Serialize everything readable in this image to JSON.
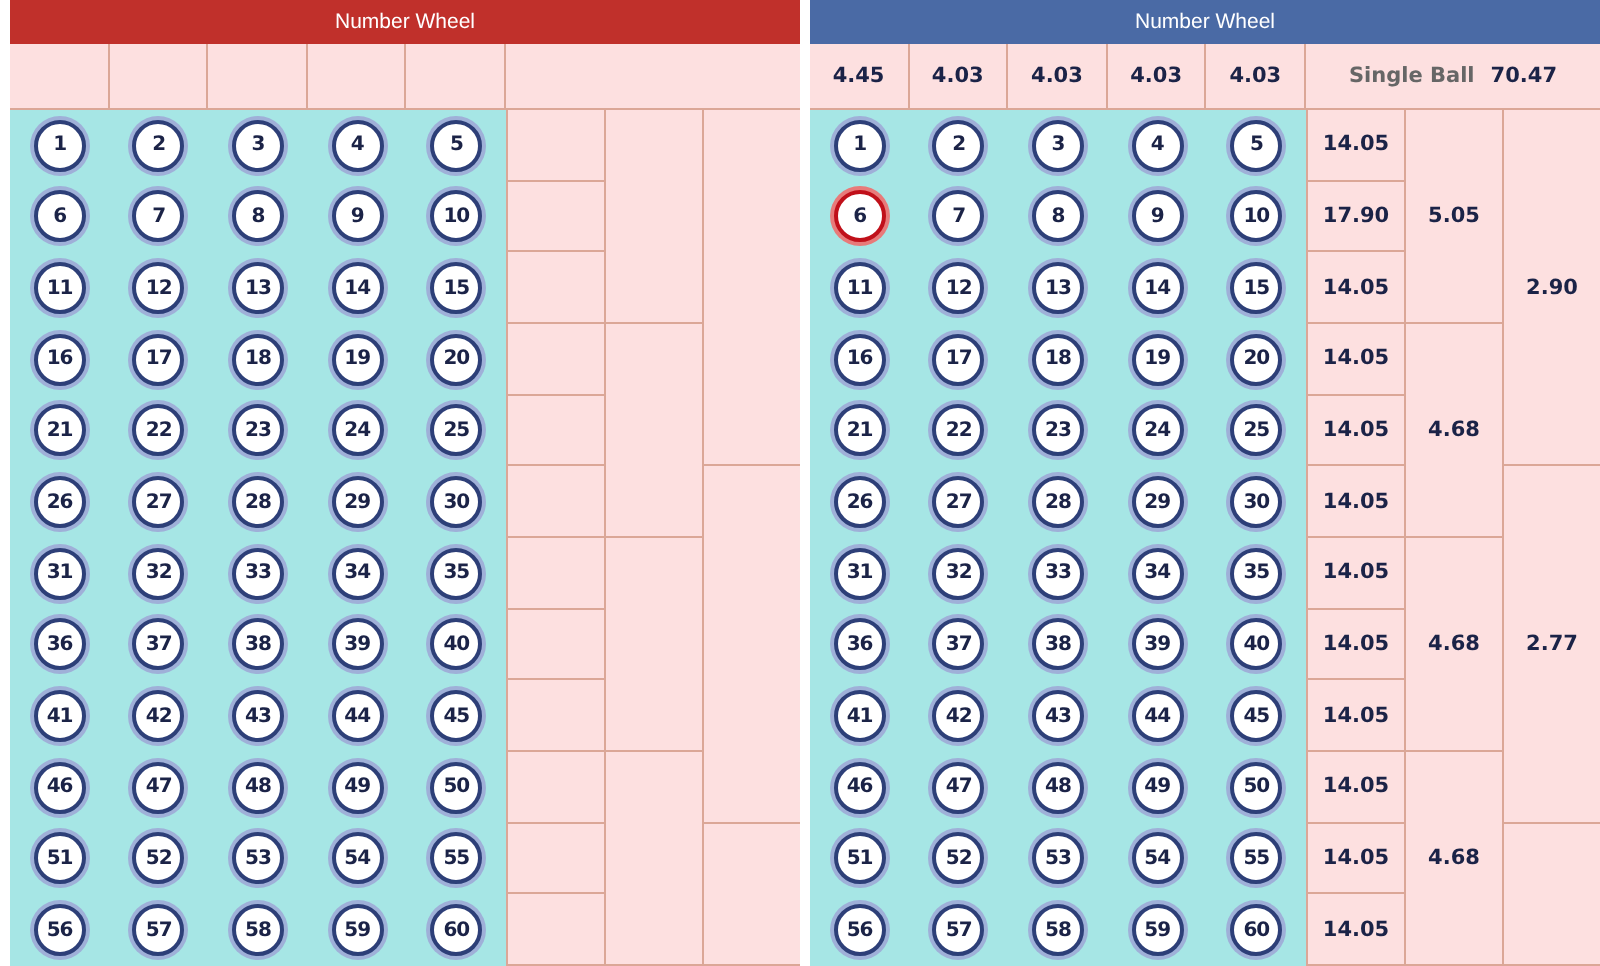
{
  "panels": [
    {
      "title": "Number Wheel",
      "color": "#c0302b",
      "balls": [
        {
          "label": "1",
          "selected": false
        },
        {
          "label": "2",
          "selected": false
        },
        {
          "label": "3",
          "selected": false
        },
        {
          "label": "4",
          "selected": false
        },
        {
          "label": "5",
          "selected": false
        },
        {
          "label": "6",
          "selected": false
        },
        {
          "label": "7",
          "selected": false
        },
        {
          "label": "8",
          "selected": false
        },
        {
          "label": "9",
          "selected": false
        },
        {
          "label": "10",
          "selected": false
        },
        {
          "label": "11",
          "selected": false
        },
        {
          "label": "12",
          "selected": false
        },
        {
          "label": "13",
          "selected": false
        },
        {
          "label": "14",
          "selected": false
        },
        {
          "label": "15",
          "selected": false
        },
        {
          "label": "16",
          "selected": false
        },
        {
          "label": "17",
          "selected": false
        },
        {
          "label": "18",
          "selected": false
        },
        {
          "label": "19",
          "selected": false
        },
        {
          "label": "20",
          "selected": false
        },
        {
          "label": "21",
          "selected": false
        },
        {
          "label": "22",
          "selected": false
        },
        {
          "label": "23",
          "selected": false
        },
        {
          "label": "24",
          "selected": false
        },
        {
          "label": "25",
          "selected": false
        },
        {
          "label": "26",
          "selected": false
        },
        {
          "label": "27",
          "selected": false
        },
        {
          "label": "28",
          "selected": false
        },
        {
          "label": "29",
          "selected": false
        },
        {
          "label": "30",
          "selected": false
        },
        {
          "label": "31",
          "selected": false
        },
        {
          "label": "32",
          "selected": false
        },
        {
          "label": "33",
          "selected": false
        },
        {
          "label": "34",
          "selected": false
        },
        {
          "label": "35",
          "selected": false
        },
        {
          "label": "36",
          "selected": false
        },
        {
          "label": "37",
          "selected": false
        },
        {
          "label": "38",
          "selected": false
        },
        {
          "label": "39",
          "selected": false
        },
        {
          "label": "40",
          "selected": false
        },
        {
          "label": "41",
          "selected": false
        },
        {
          "label": "42",
          "selected": false
        },
        {
          "label": "43",
          "selected": false
        },
        {
          "label": "44",
          "selected": false
        },
        {
          "label": "45",
          "selected": false
        },
        {
          "label": "46",
          "selected": false
        },
        {
          "label": "47",
          "selected": false
        },
        {
          "label": "48",
          "selected": false
        },
        {
          "label": "49",
          "selected": false
        },
        {
          "label": "50",
          "selected": false
        },
        {
          "label": "51",
          "selected": false
        },
        {
          "label": "52",
          "selected": false
        },
        {
          "label": "53",
          "selected": false
        },
        {
          "label": "54",
          "selected": false
        },
        {
          "label": "55",
          "selected": false
        },
        {
          "label": "56",
          "selected": false
        },
        {
          "label": "57",
          "selected": false
        },
        {
          "label": "58",
          "selected": false
        },
        {
          "label": "59",
          "selected": false
        },
        {
          "label": "60",
          "selected": false
        }
      ]
    },
    {
      "title": "Number Wheel",
      "color": "#4a6aa5",
      "column_odds": [
        "4.45",
        "4.03",
        "4.03",
        "4.03",
        "4.03"
      ],
      "single_ball": {
        "label": "Single Ball",
        "odds": "70.47"
      },
      "row_odds": [
        "14.05",
        "17.90",
        "14.05",
        "14.05",
        "14.05",
        "14.05",
        "14.05",
        "14.05",
        "14.05",
        "14.05",
        "14.05",
        "14.05"
      ],
      "triple_odds": [
        "5.05",
        "4.68",
        "4.68",
        "4.68"
      ],
      "group_odds": [
        "2.90",
        "2.77"
      ],
      "balls": [
        {
          "label": "1",
          "selected": false
        },
        {
          "label": "2",
          "selected": false
        },
        {
          "label": "3",
          "selected": false
        },
        {
          "label": "4",
          "selected": false
        },
        {
          "label": "5",
          "selected": false
        },
        {
          "label": "6",
          "selected": true
        },
        {
          "label": "7",
          "selected": false
        },
        {
          "label": "8",
          "selected": false
        },
        {
          "label": "9",
          "selected": false
        },
        {
          "label": "10",
          "selected": false
        },
        {
          "label": "11",
          "selected": false
        },
        {
          "label": "12",
          "selected": false
        },
        {
          "label": "13",
          "selected": false
        },
        {
          "label": "14",
          "selected": false
        },
        {
          "label": "15",
          "selected": false
        },
        {
          "label": "16",
          "selected": false
        },
        {
          "label": "17",
          "selected": false
        },
        {
          "label": "18",
          "selected": false
        },
        {
          "label": "19",
          "selected": false
        },
        {
          "label": "20",
          "selected": false
        },
        {
          "label": "21",
          "selected": false
        },
        {
          "label": "22",
          "selected": false
        },
        {
          "label": "23",
          "selected": false
        },
        {
          "label": "24",
          "selected": false
        },
        {
          "label": "25",
          "selected": false
        },
        {
          "label": "26",
          "selected": false
        },
        {
          "label": "27",
          "selected": false
        },
        {
          "label": "28",
          "selected": false
        },
        {
          "label": "29",
          "selected": false
        },
        {
          "label": "30",
          "selected": false
        },
        {
          "label": "31",
          "selected": false
        },
        {
          "label": "32",
          "selected": false
        },
        {
          "label": "33",
          "selected": false
        },
        {
          "label": "34",
          "selected": false
        },
        {
          "label": "35",
          "selected": false
        },
        {
          "label": "36",
          "selected": false
        },
        {
          "label": "37",
          "selected": false
        },
        {
          "label": "38",
          "selected": false
        },
        {
          "label": "39",
          "selected": false
        },
        {
          "label": "40",
          "selected": false
        },
        {
          "label": "41",
          "selected": false
        },
        {
          "label": "42",
          "selected": false
        },
        {
          "label": "43",
          "selected": false
        },
        {
          "label": "44",
          "selected": false
        },
        {
          "label": "45",
          "selected": false
        },
        {
          "label": "46",
          "selected": false
        },
        {
          "label": "47",
          "selected": false
        },
        {
          "label": "48",
          "selected": false
        },
        {
          "label": "49",
          "selected": false
        },
        {
          "label": "50",
          "selected": false
        },
        {
          "label": "51",
          "selected": false
        },
        {
          "label": "52",
          "selected": false
        },
        {
          "label": "53",
          "selected": false
        },
        {
          "label": "54",
          "selected": false
        },
        {
          "label": "55",
          "selected": false
        },
        {
          "label": "56",
          "selected": false
        },
        {
          "label": "57",
          "selected": false
        },
        {
          "label": "58",
          "selected": false
        },
        {
          "label": "59",
          "selected": false
        },
        {
          "label": "60",
          "selected": false
        }
      ]
    }
  ]
}
